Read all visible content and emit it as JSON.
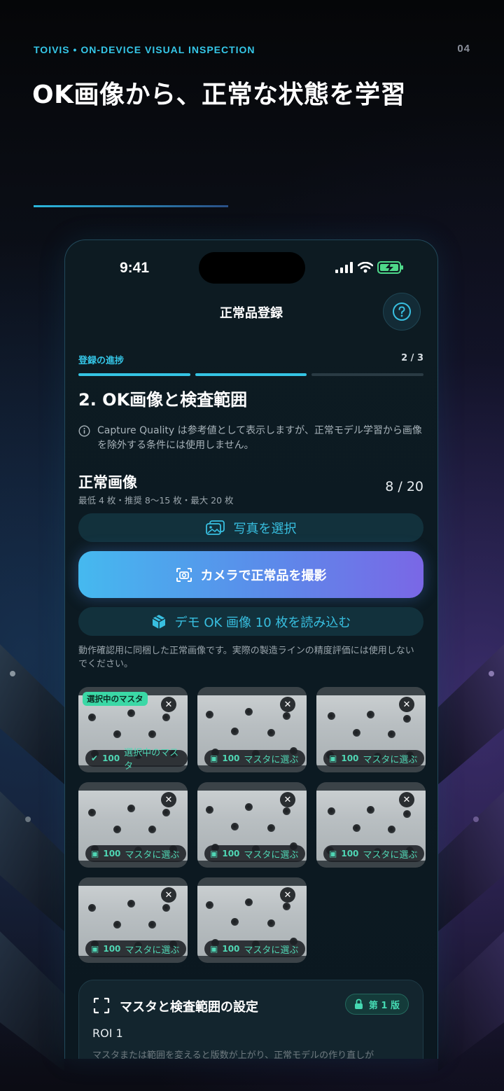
{
  "header": {
    "brand": "TOIVIS  •  ON-DEVICE VISUAL INSPECTION",
    "page_number": "04",
    "headline": "OK画像から、正常な状態を学習"
  },
  "status_bar": {
    "time": "9:41"
  },
  "nav": {
    "title": "正常品登録",
    "help_icon": "question-circle-icon"
  },
  "progress": {
    "label": "登録の進捗",
    "count": "2 / 3",
    "completed_steps": 2,
    "total_steps": 3
  },
  "step": {
    "title": "2. OK画像と検査範囲",
    "info": "Capture Quality は参考値として表示しますが、正常モデル学習から画像を除外する条件には使用しません。"
  },
  "normal_images": {
    "title": "正常画像",
    "subtitle": "最低 4 枚・推奨 8〜15 枚・最大 20 枚",
    "count": "8 / 20"
  },
  "buttons": {
    "select_photo": "写真を選択",
    "camera": "カメラで正常品を撮影",
    "demo": "デモ OK 画像 10 枚を読み込む"
  },
  "demo_note": "動作確認用に同梱した正常画像です。実際の製造ラインの精度評価には使用しないでください。",
  "thumbnails": [
    {
      "tag": "選択中のマスタ",
      "chip": "選択中のマスタ",
      "score": "100",
      "selected": true
    },
    {
      "chip": "マスタに選ぶ",
      "score": "100"
    },
    {
      "chip": "マスタに選ぶ",
      "score": "100"
    },
    {
      "chip": "マスタに選ぶ",
      "score": "100"
    },
    {
      "chip": "マスタに選ぶ",
      "score": "100"
    },
    {
      "chip": "マスタに選ぶ",
      "score": "100"
    },
    {
      "chip": "マスタに選ぶ",
      "score": "100"
    },
    {
      "chip": "マスタに選ぶ",
      "score": "100"
    }
  ],
  "master_settings": {
    "title": "マスタと検査範囲の設定",
    "badge": "第 1 版",
    "roi": "ROI 1",
    "description": "マスタまたは範囲を変えると版数が上がり、正常モデルの作り直しが"
  },
  "colors": {
    "accent": "#35c7e8",
    "success": "#3bd8a6",
    "gradient_start": "#45b9ef",
    "gradient_end": "#7a67e6"
  }
}
